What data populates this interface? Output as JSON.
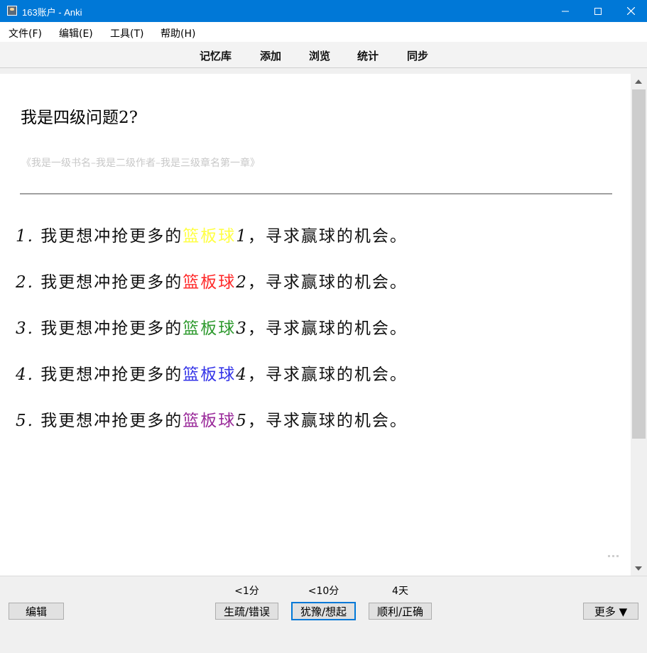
{
  "window": {
    "title": "163账户 - Anki"
  },
  "menu": [
    "文件(F)",
    "编辑(E)",
    "工具(T)",
    "帮助(H)"
  ],
  "toolbar": [
    "记忆库",
    "添加",
    "浏览",
    "统计",
    "同步"
  ],
  "card": {
    "question": "我是四级问题2?",
    "source": "《我是一级书名–我是二级作者–我是三级章名第一章》",
    "answers": [
      {
        "num": "1.",
        "before": " 我更想冲抢更多的",
        "highlight": "篮板球",
        "highlight_color": "#ffff44",
        "after_num": "1",
        "rest": "，寻求赢球的机会。"
      },
      {
        "num": "2.",
        "before": " 我更想冲抢更多的",
        "highlight": "篮板球",
        "highlight_color": "#ff2a2a",
        "after_num": "2",
        "rest": "，寻求赢球的机会。"
      },
      {
        "num": "3.",
        "before": " 我更想冲抢更多的",
        "highlight": "篮板球",
        "highlight_color": "#2e9a2e",
        "after_num": "3",
        "rest": "，寻求赢球的机会。"
      },
      {
        "num": "4.",
        "before": " 我更想冲抢更多的",
        "highlight": "篮板球",
        "highlight_color": "#3434e8",
        "after_num": "4",
        "rest": "，寻求赢球的机会。"
      },
      {
        "num": "5.",
        "before": " 我更想冲抢更多的",
        "highlight": "篮板球",
        "highlight_color": "#9a2a9a",
        "after_num": "5",
        "rest": "，寻求赢球的机会。"
      }
    ]
  },
  "bottom": {
    "edit_label": "编辑",
    "more_label": "更多 ▼",
    "intervals": [
      "<1分",
      "<10分",
      "4天"
    ],
    "answer_buttons": [
      "生疏/错误",
      "犹豫/想起",
      "顺利/正确"
    ]
  }
}
